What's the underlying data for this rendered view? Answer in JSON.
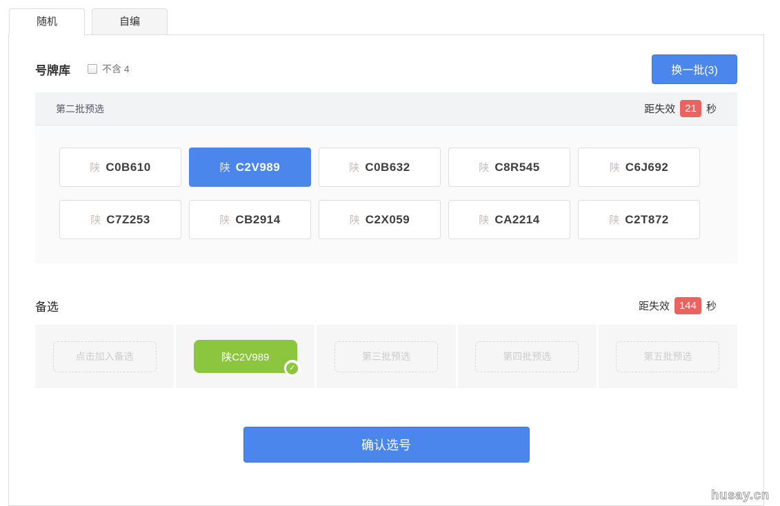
{
  "tabs": [
    {
      "label": "随机",
      "active": true
    },
    {
      "label": "自编",
      "active": false
    }
  ],
  "pool": {
    "title": "号牌库",
    "exclude_checkbox": {
      "label": "不含 4",
      "checked": false
    },
    "refresh_button": {
      "label": "换一批(3)"
    },
    "batch_header": {
      "title": "第二批预选",
      "expire_label": "距失效",
      "expire_seconds": "21",
      "unit": "秒"
    },
    "plates": [
      {
        "prefix": "陕",
        "number": "C0B610",
        "selected": false
      },
      {
        "prefix": "陕",
        "number": "C2V989",
        "selected": true
      },
      {
        "prefix": "陕",
        "number": "C0B632",
        "selected": false
      },
      {
        "prefix": "陕",
        "number": "C8R545",
        "selected": false
      },
      {
        "prefix": "陕",
        "number": "C6J692",
        "selected": false
      },
      {
        "prefix": "陕",
        "number": "C7Z253",
        "selected": false
      },
      {
        "prefix": "陕",
        "number": "CB2914",
        "selected": false
      },
      {
        "prefix": "陕",
        "number": "C2X059",
        "selected": false
      },
      {
        "prefix": "陕",
        "number": "CA2214",
        "selected": false
      },
      {
        "prefix": "陕",
        "number": "C2T872",
        "selected": false
      }
    ]
  },
  "alternatives": {
    "title": "备选",
    "expire_label": "距失效",
    "expire_seconds": "144",
    "unit": "秒",
    "check_icon": "✓",
    "slots": [
      {
        "type": "add",
        "label": "点击加入备选"
      },
      {
        "type": "selected",
        "label": "陕C2V989"
      },
      {
        "type": "placeholder",
        "label": "第三批预选"
      },
      {
        "type": "placeholder",
        "label": "第四批预选"
      },
      {
        "type": "placeholder",
        "label": "第五批预选"
      }
    ]
  },
  "confirm_button": {
    "label": "确认选号"
  },
  "watermark": "husay.cn",
  "colors": {
    "accent_blue": "#4a86ec",
    "alert_red": "#e96361",
    "success_green": "#8cc63f"
  }
}
